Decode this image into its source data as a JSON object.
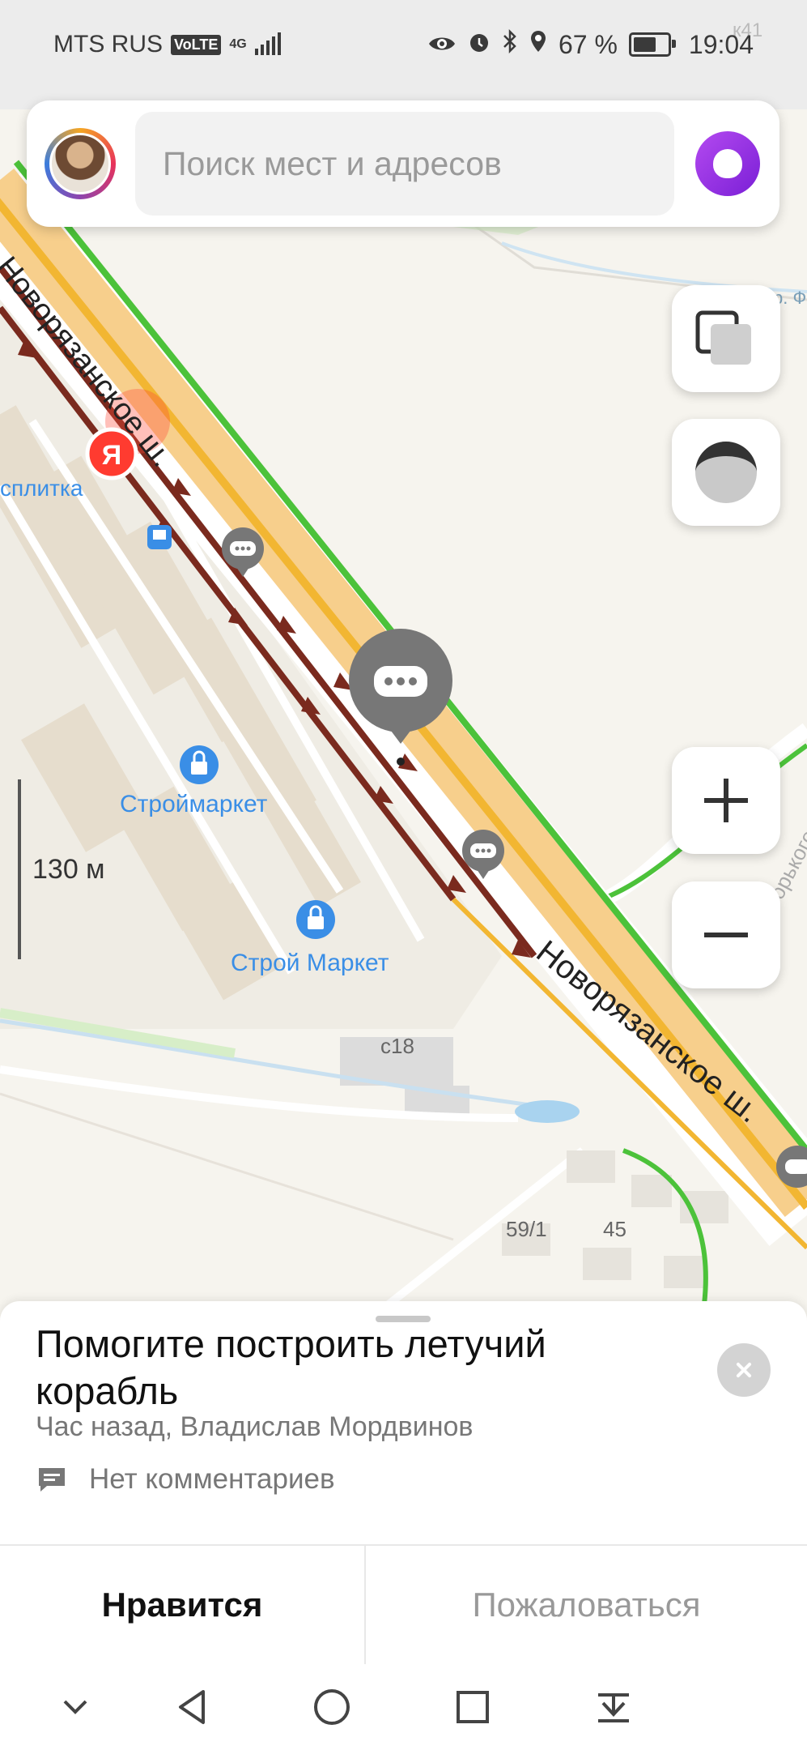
{
  "status_bar": {
    "carrier": "MTS RUS",
    "volte": "VoLTE",
    "network": "4G",
    "battery": "67 %",
    "battery_level": 0.67,
    "time": "19:04",
    "icons": [
      "eye-icon",
      "alarm-icon",
      "bluetooth-icon",
      "location-icon",
      "battery-icon"
    ]
  },
  "search": {
    "placeholder": "Поиск мест и адресов"
  },
  "map": {
    "road_label_top": "Новорязанское ш.",
    "road_label_bottom": "Новорязанское ш.",
    "side_street": "ул. Горького",
    "poi_partial": "сплитка",
    "poi_1": "Строймаркет",
    "poi_2": "Строй Маркет",
    "building_1": "с18",
    "building_2": "59/1",
    "building_3": "45",
    "marker_letter": "Я",
    "corner_text": "к41",
    "corner_text_2": "р. Ф"
  },
  "scale": {
    "label": "130 м"
  },
  "sheet": {
    "title": "Помогите построить летучий корабль",
    "meta": "Час назад, Владислав Мордвинов",
    "comments": "Нет комментариев",
    "like_label": "Нравится",
    "report_label": "Пожаловаться"
  },
  "colors": {
    "accent_alice": "#8a2be2",
    "traffic_heavy": "#7a2a1e",
    "traffic_medium": "#f2b632",
    "traffic_free": "#4cc23a",
    "poi_blue": "#3a8ee6"
  }
}
